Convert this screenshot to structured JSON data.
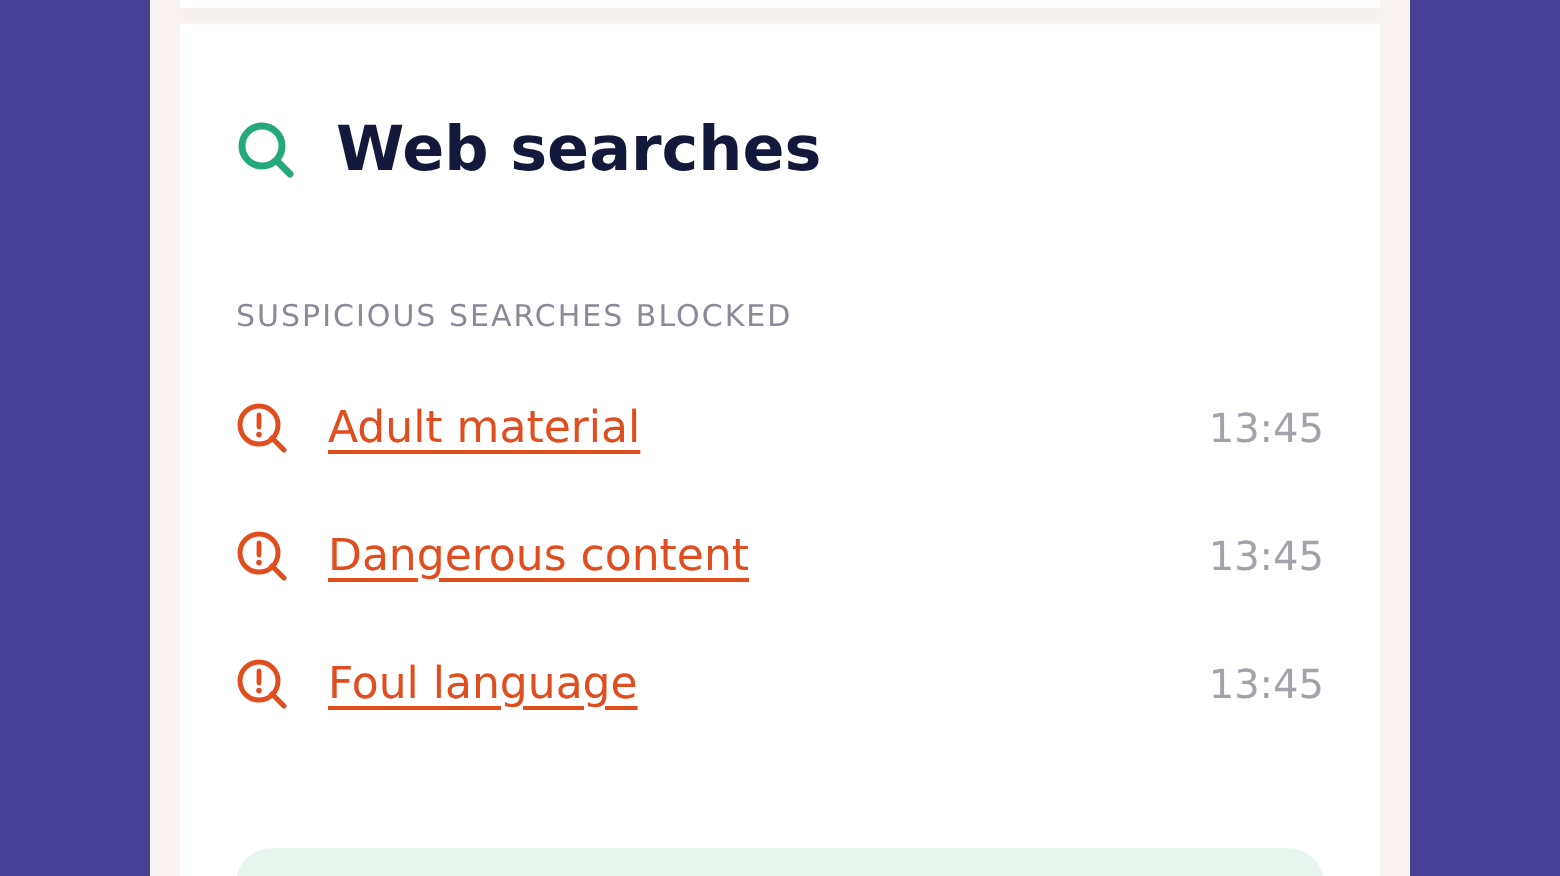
{
  "card": {
    "title": "Web searches",
    "section_label": "SUSPICIOUS SEARCHES BLOCKED",
    "searches": [
      {
        "label": "Adult material",
        "time": "13:45"
      },
      {
        "label": "Dangerous content",
        "time": "13:45"
      },
      {
        "label": "Foul language",
        "time": "13:45"
      }
    ]
  }
}
